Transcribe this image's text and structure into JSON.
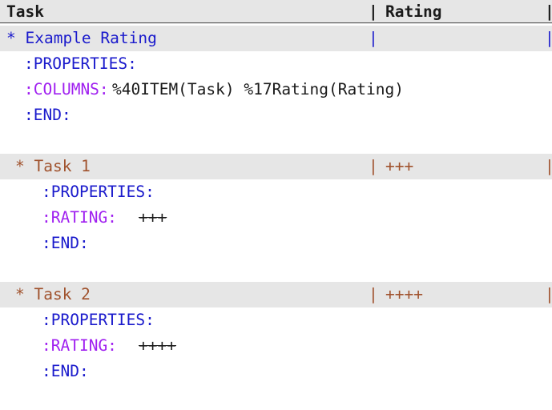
{
  "header": {
    "task_label": "Task",
    "rating_label": "Rating",
    "separator": "|"
  },
  "heading_main": {
    "text": "* Example Rating"
  },
  "main_props": {
    "properties": ":PROPERTIES:",
    "columns_key": ":COLUMNS:",
    "columns_value": "%40ITEM(Task) %17Rating(Rating)",
    "end": ":END:"
  },
  "task1": {
    "heading": "* Task 1",
    "rating": "+++",
    "properties": ":PROPERTIES:",
    "rating_key": ":RATING:",
    "rating_value": "+++",
    "end": ":END:"
  },
  "task2": {
    "heading": "* Task 2",
    "rating": "++++",
    "properties": ":PROPERTIES:",
    "rating_key": ":RATING:",
    "rating_value": "++++",
    "end": ":END:"
  },
  "colors": {
    "keyword_blue": "#1a1acc",
    "heading_brown": "#a0522d",
    "property_purple": "#a020f0",
    "band_gray": "#e6e6e6"
  }
}
